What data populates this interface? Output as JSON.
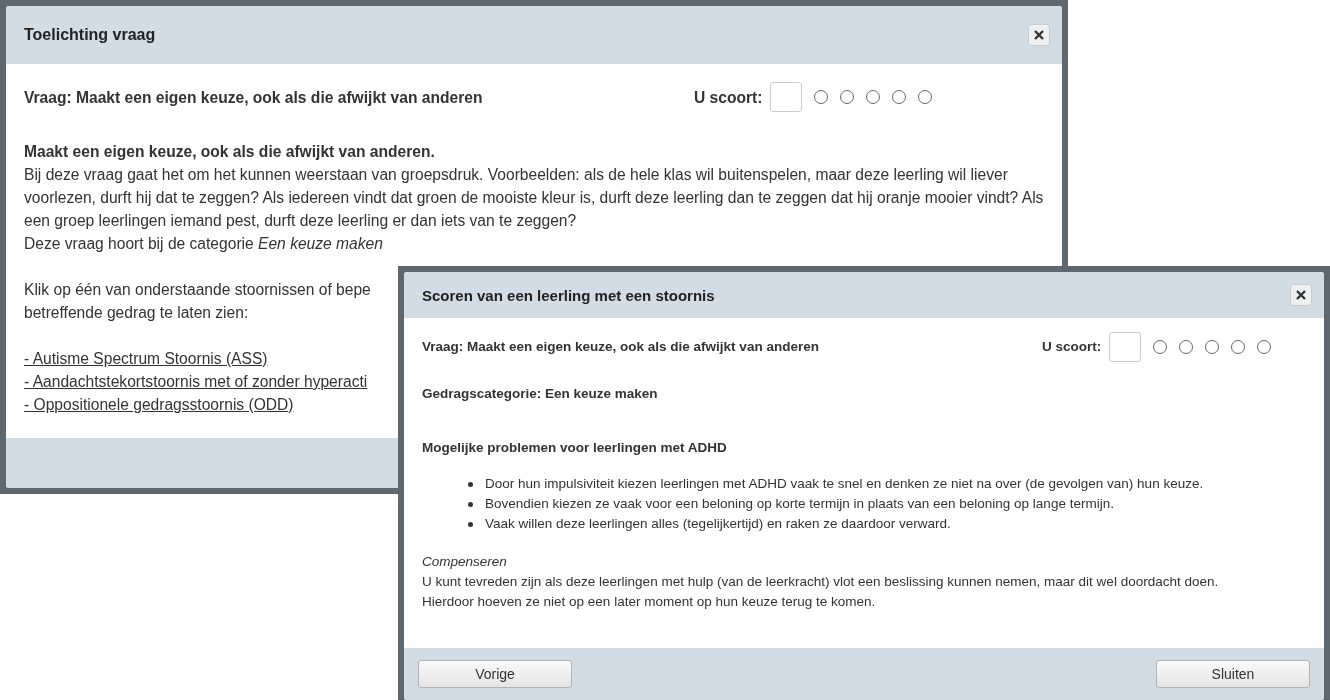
{
  "dialogs": [
    {
      "title": "Toelichting vraag",
      "question": "Vraag: Maakt een eigen keuze, ook als die afwijkt van anderen",
      "score_label": "U scoort:",
      "score_options": [
        {
          "selected": false
        },
        {
          "selected": false
        },
        {
          "selected": false
        },
        {
          "selected": false
        },
        {
          "selected": false
        }
      ],
      "blocks": [
        {
          "kind": "heading",
          "text": "Maakt een eigen keuze, ook als die afwijkt van anderen."
        },
        {
          "kind": "paragraph",
          "text": "Bij deze vraag gaat het om het kunnen weerstaan van groepsdruk. Voorbeelden: als de hele klas wil buitenspelen, maar deze leerling wil liever voorlezen, durft hij dat te zeggen? Als iedereen vindt dat groen de mooiste kleur is, durft deze leerling dan te zeggen dat hij oranje mooier vindt? Als een groep leerlingen iemand pest, durft deze leerling er dan iets van te zeggen?"
        },
        {
          "kind": "line",
          "text": "Deze vraag hoort bij de categorie *Een keuze maken*"
        },
        {
          "kind": "gap"
        },
        {
          "kind": "line",
          "text": "Klik op één van onderstaande stoornissen of bepe"
        },
        {
          "kind": "line",
          "text": "betreffende gedrag te laten zien:"
        },
        {
          "kind": "gap"
        },
        {
          "kind": "link",
          "text": "- Autisme Spectrum Stoornis (ASS)"
        },
        {
          "kind": "link",
          "text": "- Aandachtstekortstoornis met of zonder hyperacti"
        },
        {
          "kind": "link",
          "text": "- Oppositionele gedragsstoornis (ODD)"
        }
      ]
    },
    {
      "title": "Scoren van een leerling met een stoornis",
      "question": "Vraag: Maakt een eigen keuze, ook als die afwijkt van anderen",
      "score_label": "U scoort:",
      "score_options": [
        {
          "selected": false
        },
        {
          "selected": false
        },
        {
          "selected": false
        },
        {
          "selected": false
        },
        {
          "selected": false
        }
      ],
      "blocks": [
        {
          "kind": "subheading",
          "text": "Gedragscategorie: Een keuze maken"
        },
        {
          "kind": "gap"
        },
        {
          "kind": "subheading",
          "text": "Mogelijke problemen voor leerlingen met ADHD"
        },
        {
          "kind": "bullet",
          "text": "Door hun impulsiviteit kiezen leerlingen met ADHD vaak te snel en denken ze niet na over (de gevolgen van) hun keuze."
        },
        {
          "kind": "bullet",
          "text": "Bovendien kiezen ze vaak voor een beloning op korte termijn in plaats van een beloning op lange termijn."
        },
        {
          "kind": "bullet",
          "text": "Vaak willen deze leerlingen alles (tegelijkertijd) en raken ze daardoor verward."
        },
        {
          "kind": "gap"
        },
        {
          "kind": "italic",
          "text": "Compenseren"
        },
        {
          "kind": "line",
          "text": "U kunt tevreden zijn als deze leerlingen met hulp (van de leerkracht) vlot een beslissing kunnen nemen, maar dit wel doordacht doen."
        },
        {
          "kind": "line",
          "text": "Hierdoor hoeven ze niet op een later moment op hun keuze terug te komen."
        }
      ],
      "buttons": [
        "Vorige",
        "Sluiten"
      ]
    }
  ]
}
